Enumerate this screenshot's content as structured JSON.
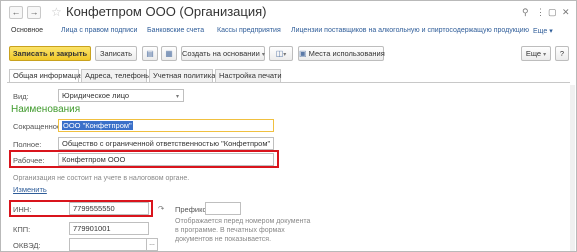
{
  "title": "Конфетпром ООО (Организация)",
  "nav": {
    "back": "←",
    "forward": "→",
    "star": "☆"
  },
  "window_controls": {
    "link": "⚲",
    "menu": "⋮",
    "maximize": "▢",
    "close": "✕"
  },
  "menu": {
    "items": [
      "Основное",
      "Лица с правом подписи",
      "Банковские счета",
      "Кассы предприятия",
      "Лицензии поставщиков на алкогольную и спиртосодержащую продукцию",
      "Еще ▾"
    ]
  },
  "toolbar": {
    "save_close": "Записать и закрыть",
    "save": "Записать",
    "create_based": "Создать на основании",
    "usage_places": "Места использования",
    "more": "Еще",
    "help": "?"
  },
  "tabs": [
    "Общая информация",
    "Адреса, телефоны",
    "Учетная политика",
    "Настройка печати"
  ],
  "form": {
    "vid_label": "Вид:",
    "vid_value": "Юридическое лицо",
    "section_title": "Наименования",
    "short_label": "Сокращенное:",
    "short_value": "ООО \"Конфетпром\"",
    "full_label": "Полное:",
    "full_value": "Общество с ограниченной ответственностью \"Конфетпром\"",
    "work_label": "Рабочее:",
    "work_value": "Конфетпром ООО",
    "tax_note": "Организация не состоит на учете в налоговом органе.",
    "change_link": "Изменить",
    "inn_label": "ИНН:",
    "inn_value": "7799555550",
    "kpp_label": "КПП:",
    "kpp_value": "779901001",
    "okved_label": "ОКВЭД:",
    "okved_value": "",
    "prefix_label": "Префикс:",
    "prefix_value": "",
    "prefix_hint": "Отображается перед номером документа в программе. В печатных формах документов не показывается."
  },
  "colors": {
    "highlight": "#d9141c",
    "section": "#3f9a2c",
    "primary_button": "#f1c92a",
    "link": "#2f5d99"
  }
}
